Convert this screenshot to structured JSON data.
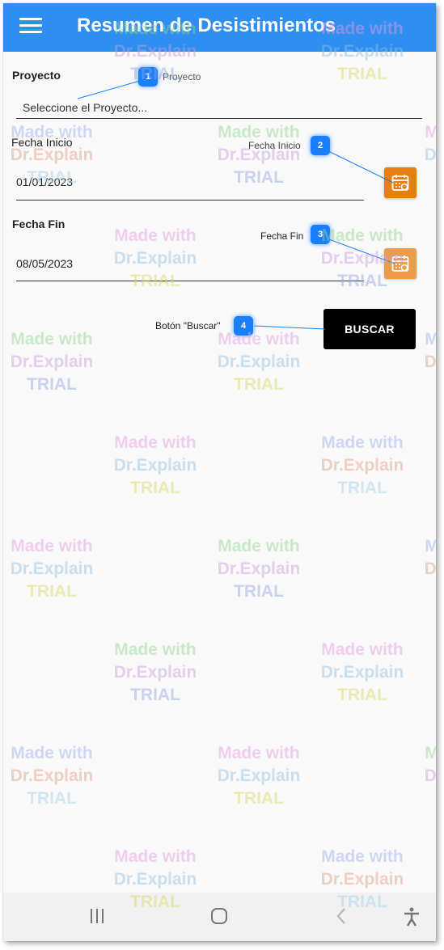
{
  "header": {
    "title": "Resumen de Desistimientos",
    "menu_icon": "hamburger-menu-icon",
    "color": "#2f8ff0"
  },
  "form": {
    "proyecto": {
      "label": "Proyecto",
      "placeholder": "Seleccione el Proyecto..."
    },
    "fecha_inicio": {
      "label": "Fecha Inicio",
      "value": "01/01/2023"
    },
    "fecha_fin": {
      "label": "Fecha Fin",
      "value": "08/05/2023"
    },
    "calendar_icon": "calendar-icon",
    "calendar_color": "#e67e10",
    "buscar_label": "BUSCAR"
  },
  "callouts": [
    {
      "number": "1",
      "text": "Proyecto"
    },
    {
      "number": "2",
      "text": "Fecha Inicio"
    },
    {
      "number": "3",
      "text": "Fecha Fin"
    },
    {
      "number": "4",
      "text": "Botón \"Buscar\""
    }
  ],
  "navbar": {
    "recents_icon": "recents-icon",
    "home_icon": "home-icon",
    "back_icon": "back-icon",
    "accessibility_icon": "accessibility-icon"
  },
  "watermark": {
    "line1": "Made with",
    "line2": "Dr.Explain",
    "line3": "TRIAL"
  }
}
